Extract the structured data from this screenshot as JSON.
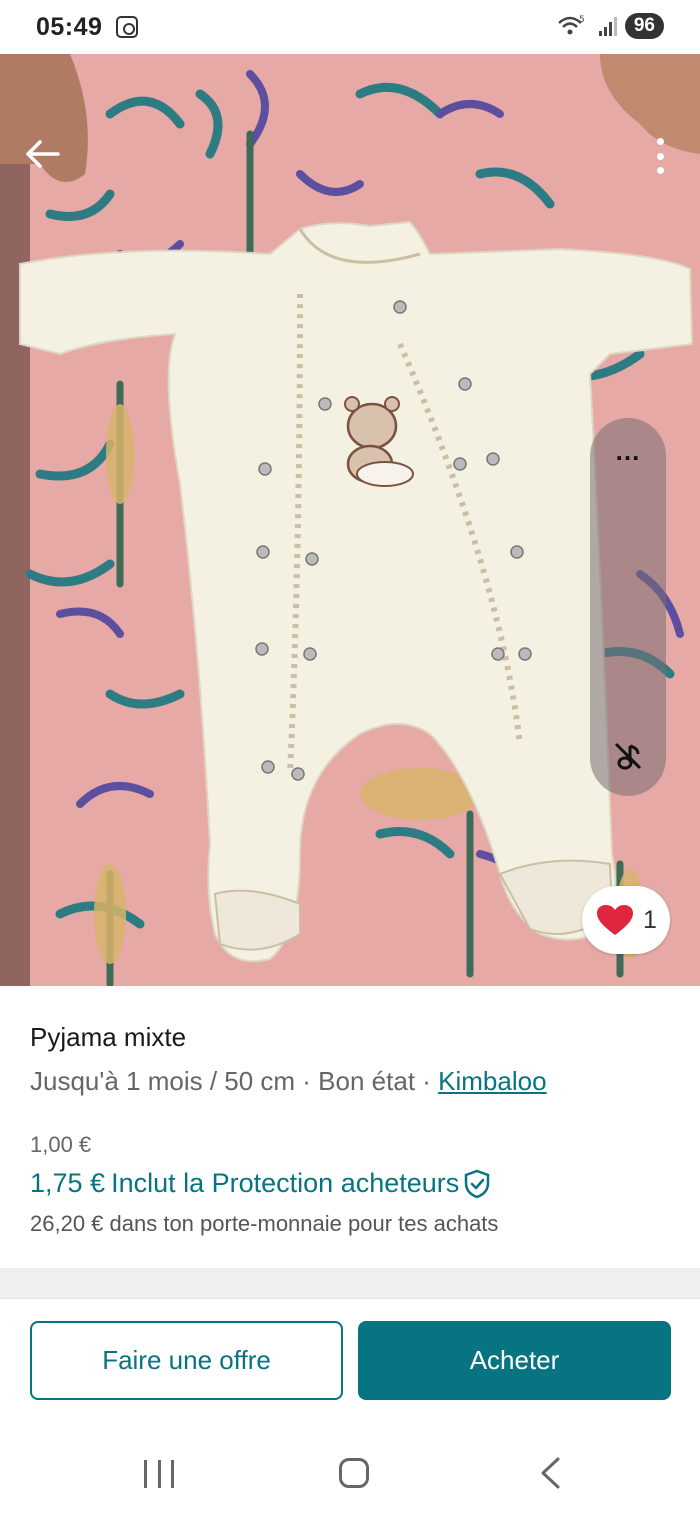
{
  "status_bar": {
    "time": "05:49",
    "battery": "96",
    "icons": [
      "screen-capture-icon",
      "wifi-icon",
      "signal-icon",
      "battery-icon"
    ]
  },
  "photo": {
    "icons": [
      "back-arrow-icon",
      "more-vertical-icon",
      "mute-icon",
      "heart-icon"
    ],
    "side_panel_dots": "...",
    "likes": "1",
    "heart_color": "#e0253e"
  },
  "item": {
    "title": "Pyjama mixte",
    "subtitle_prefix": "Jusqu'à 1 mois / 50 cm · Bon état · ",
    "brand": "Kimbaloo",
    "price": "1,00 €",
    "total_price": "1,75 €",
    "protection": "Inclut la Protection acheteurs",
    "wallet": "26,20 € dans ton porte-monnaie pour tes achats"
  },
  "actions": {
    "offer_label": "Faire une offre",
    "buy_label": "Acheter"
  },
  "colors": {
    "accent": "#087481",
    "blanket_pink": "#e7a9a6"
  }
}
